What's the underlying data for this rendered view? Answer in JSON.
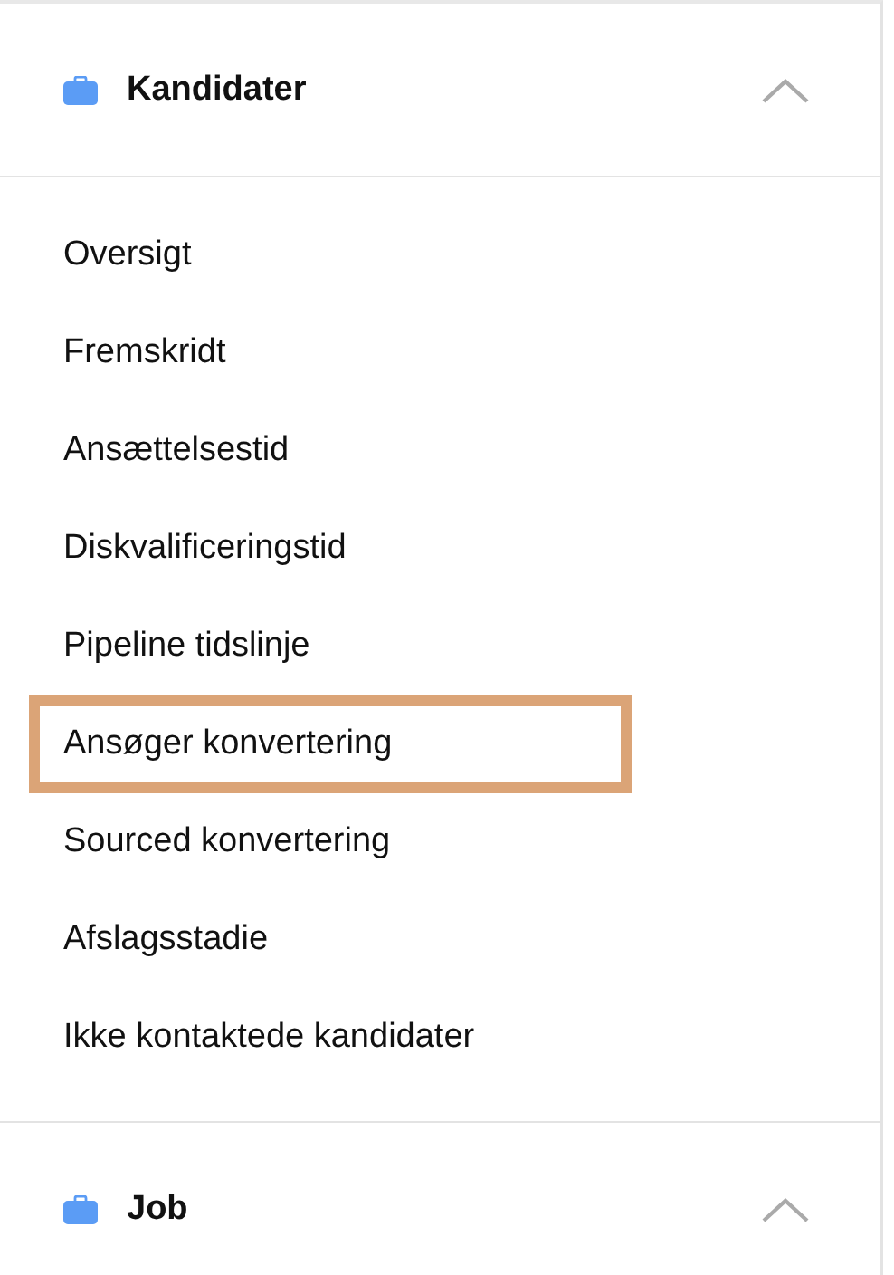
{
  "sections": [
    {
      "title": "Kandidater",
      "expanded": true,
      "items": [
        {
          "label": "Oversigt",
          "highlighted": false
        },
        {
          "label": "Fremskridt",
          "highlighted": false
        },
        {
          "label": "Ansættelsestid",
          "highlighted": false
        },
        {
          "label": "Diskvalificeringstid",
          "highlighted": false
        },
        {
          "label": "Pipeline tidslinje",
          "highlighted": false
        },
        {
          "label": "Ansøger konvertering",
          "highlighted": true
        },
        {
          "label": "Sourced konvertering",
          "highlighted": false
        },
        {
          "label": "Afslagsstadie",
          "highlighted": false
        },
        {
          "label": "Ikke kontaktede kandidater",
          "highlighted": false
        }
      ]
    },
    {
      "title": "Job",
      "expanded": true
    }
  ]
}
